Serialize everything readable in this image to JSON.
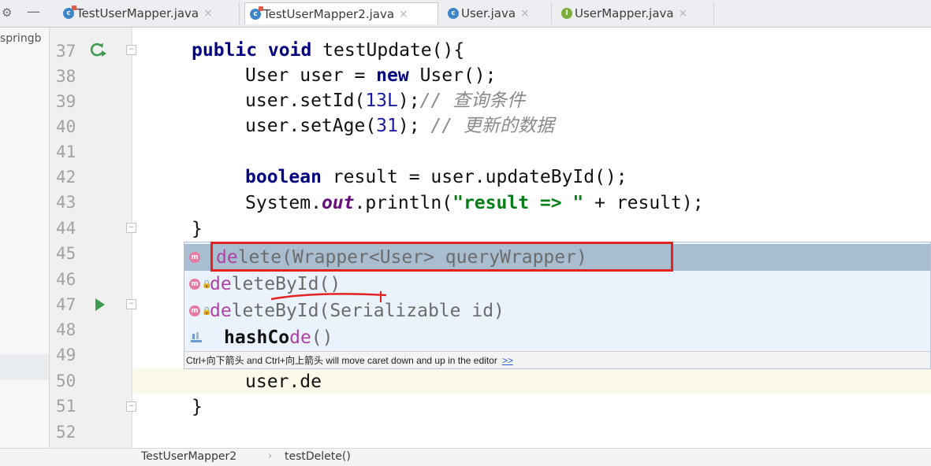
{
  "window": {
    "project_label": "springb"
  },
  "tabs": [
    {
      "label": "TestUserMapper.java",
      "icon": "class-icon",
      "active": false
    },
    {
      "label": "TestUserMapper2.java",
      "icon": "class-icon",
      "active": true
    },
    {
      "label": "User.java",
      "icon": "class-icon",
      "active": false
    },
    {
      "label": "UserMapper.java",
      "icon": "interface-icon",
      "active": false
    }
  ],
  "tab_close_glyph": "×",
  "line_numbers": [
    "37",
    "38",
    "39",
    "40",
    "41",
    "42",
    "43",
    "44",
    "45",
    "46",
    "47",
    "48",
    "49",
    "50",
    "51",
    "52"
  ],
  "code": {
    "l37_kw": "public void ",
    "l37_rest": "testUpdate(){",
    "l38_a": "User user = ",
    "l38_kw": "new ",
    "l38_b": "User();",
    "l39_a": "user.setId(",
    "l39_num": "13L",
    "l39_b": ");",
    "l39_cm": "// 查询条件",
    "l40_a": "user.setAge(",
    "l40_num": "31",
    "l40_b": "); ",
    "l40_cm": "// 更新的数据",
    "l42_kw": "boolean ",
    "l42_rest": "result = user.updateById();",
    "l43_a": "System.",
    "l43_fld": "out",
    "l43_b": ".println(",
    "l43_str": "\"result => \"",
    "l43_c": " + result);",
    "l44": "}",
    "l50": "user.de",
    "l51": "}"
  },
  "completion": {
    "items": [
      {
        "prefix": "de",
        "rest": "lete(Wrapper<User> queryWrapper)",
        "icon": "method-icon",
        "selected": true
      },
      {
        "prefix": "de",
        "rest": "leteById()",
        "icon": "method-icon",
        "selected": false
      },
      {
        "prefix": "de",
        "rest": "leteById(Serializable id)",
        "icon": "method-icon",
        "selected": false
      },
      {
        "bold": "hashCo",
        "hl": "de",
        "rest": "()",
        "icon": "java-icon",
        "selected": false
      }
    ],
    "hint_text": "Ctrl+向下箭头 and Ctrl+向上箭头 will move caret down and up in the editor",
    "hint_link": ">>"
  },
  "method_icon_glyph": "m",
  "breadcrumb": {
    "class_name": "TestUserMapper2",
    "separator": "›",
    "method_name": "testDelete()"
  },
  "colors": {
    "accent": "#3e86c9",
    "annotation_red": "#e52222",
    "selection": "#a9bdd1",
    "popup_bg": "#eaf2fb"
  }
}
